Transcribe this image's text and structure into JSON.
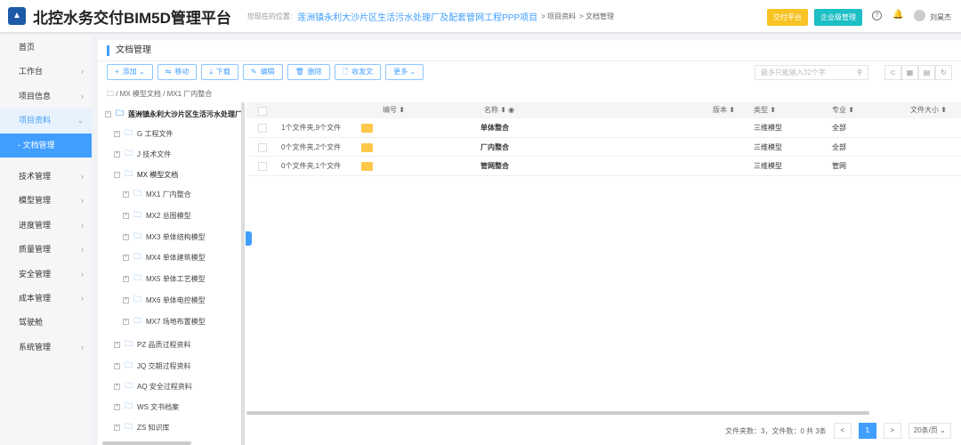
{
  "header": {
    "title": "北控水务交付BIM5D管理平台",
    "location_label": "您现在的位置:",
    "project": "莲洲镇永利大沙片区生活污水处理厂及配套管网工程PPP项目",
    "crumbs": [
      "> 项目资料",
      "> 文档管理"
    ],
    "btn_delivery": "交付平台",
    "btn_enterprise": "企业级管理",
    "user": "刘昊杰"
  },
  "sidebar": {
    "items": [
      {
        "label": "首页"
      },
      {
        "label": "工作台"
      },
      {
        "label": "项目信息"
      },
      {
        "label": "项目资料"
      },
      {
        "label": "- 文档管理"
      },
      {
        "label": "技术管理"
      },
      {
        "label": "模型管理"
      },
      {
        "label": "进度管理"
      },
      {
        "label": "质量管理"
      },
      {
        "label": "安全管理"
      },
      {
        "label": "成本管理"
      },
      {
        "label": "驾驶舱"
      },
      {
        "label": "系统管理"
      }
    ]
  },
  "page": {
    "title": "文档管理",
    "path": "/ MX 模型文档 / MX1 厂内整合",
    "search_placeholder": "最多只能输入32个字"
  },
  "toolbar": [
    {
      "icon": "+",
      "label": "添加 ⌄"
    },
    {
      "icon": "⇋",
      "label": "移动"
    },
    {
      "icon": "⤓",
      "label": "下载"
    },
    {
      "icon": "✎",
      "label": "编辑"
    },
    {
      "icon": "🗑",
      "label": "删除"
    },
    {
      "icon": "🗋",
      "label": "收发文"
    },
    {
      "icon": "",
      "label": "更多 ⌄"
    }
  ],
  "tree": {
    "root": "莲洲镇永利大沙片区生活污水处理厂及配套管网工程PPP项目",
    "nodes": [
      "G 工程文件",
      "J 技术文件",
      "MX 模型文档",
      "MX1 厂内整合",
      "MX2 总图模型",
      "MX3 单体结构模型",
      "MX4 单体建筑模型",
      "MX5 单体工艺模型",
      "MX6 单体电控模型",
      "MX7 场地布置模型",
      "PZ 品质过程资料",
      "JQ 交期过程资料",
      "AQ 安全过程资料",
      "WS 文书档案",
      "ZS 知识库"
    ]
  },
  "table": {
    "columns": [
      "编号 ⬍",
      "名称 ⬍ ◉",
      "版本 ⬍",
      "类型 ⬍",
      "专业 ⬍",
      "文件大小 ⬍"
    ],
    "rows": [
      {
        "count": "1个文件夹,9个文件",
        "name": "单体整合",
        "type": "三维模型",
        "major": "全部"
      },
      {
        "count": "0个文件夹,2个文件",
        "name": "厂内整合",
        "type": "三维模型",
        "major": "全部"
      },
      {
        "count": "0个文件夹,1个文件",
        "name": "管网整合",
        "type": "三维模型",
        "major": "管网"
      }
    ]
  },
  "footer": {
    "summary": "文件夹数：3，文件数：0 共 3条",
    "page": "1",
    "page_size": "20条/页 ⌄",
    "prev": "<",
    "next": ">"
  }
}
